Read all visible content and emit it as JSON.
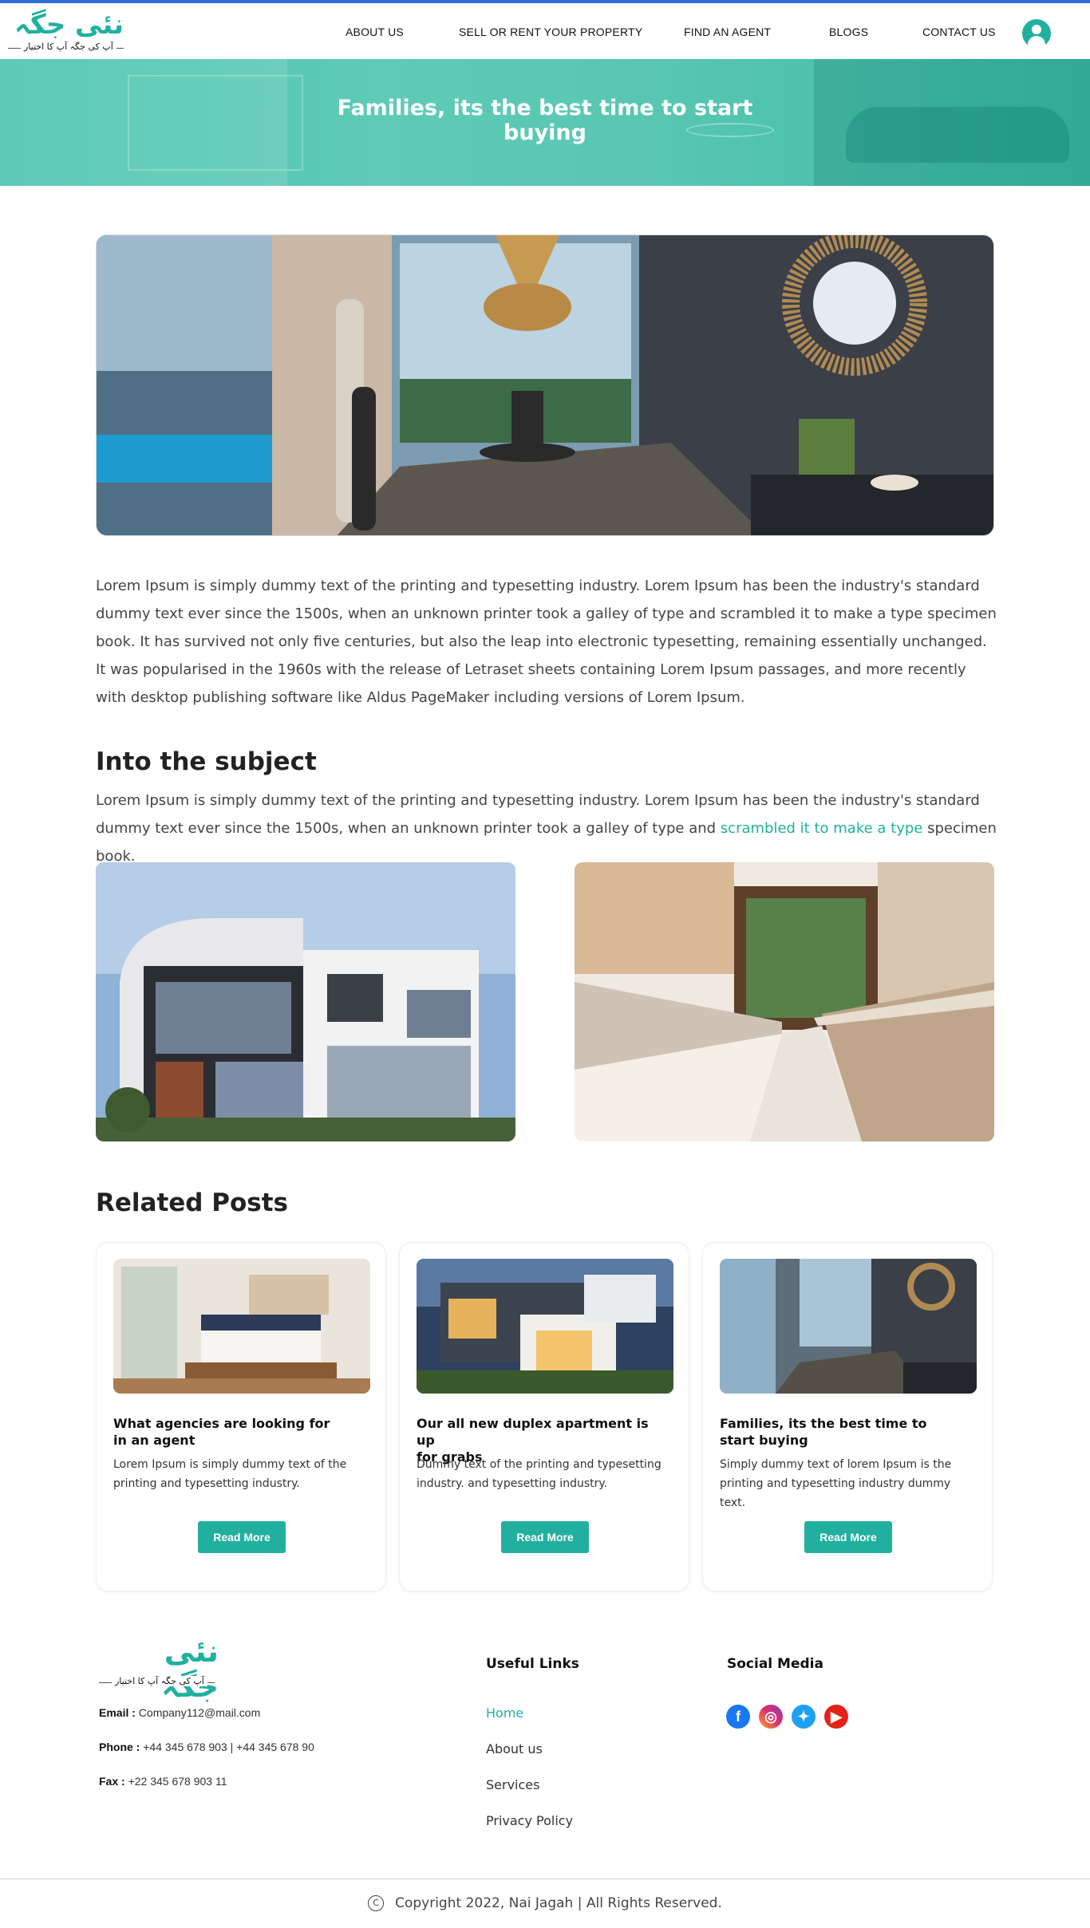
{
  "header": {
    "logo_text": "نئی جگہ",
    "logo_tagline": "آپ کی جگہ آپ کا اختیار",
    "nav": [
      "ABOUT US",
      "SELL OR RENT YOUR PROPERTY",
      "FIND AN AGENT",
      "BLOGS",
      "CONTACT US"
    ],
    "user_icon": "user-circle-icon"
  },
  "hero": {
    "title": "Families, its the best time to start buying"
  },
  "article": {
    "intro": "Lorem Ipsum is simply dummy text of the printing and typesetting industry. Lorem Ipsum has been the industry's standard dummy text ever since the 1500s, when an unknown printer took a galley of type and scrambled it to make a type specimen book. It has survived not only five centuries, but also the leap into electronic typesetting, remaining essentially unchanged. It was popularised in the 1960s with the release of Letraset sheets containing Lorem Ipsum passages, and more recently with desktop publishing software like Aldus PageMaker including versions of Lorem Ipsum.",
    "subject_heading": "Into the subject",
    "subject_text_before": "Lorem Ipsum is simply dummy text of the printing and typesetting industry. Lorem Ipsum has been the industry's standard dummy text ever since the 1500s, when an unknown printer took a galley of type and ",
    "subject_link": "scrambled it to make a type",
    "subject_text_after": " specimen book."
  },
  "related": {
    "heading": "Related Posts",
    "posts": [
      {
        "title": "What agencies are looking for\nin an agent",
        "text": "Lorem Ipsum is simply dummy text of the printing and typesetting industry.",
        "button": "Read More"
      },
      {
        "title": "Our all new duplex apartment is up\nfor grabs",
        "text": "Dummy text of the printing and typesetting industry. and typesetting industry.",
        "button": "Read More"
      },
      {
        "title": "Families, its the best time to\n start buying",
        "text": "Simply dummy text of lorem Ipsum is  the printing and typesetting industry dummy text.",
        "button": "Read More"
      }
    ]
  },
  "footer": {
    "email_label": "Email :",
    "email": "Company112@mail.com",
    "phone_label": "Phone :",
    "phone": "+44 345 678 903  | +44 345 678 90",
    "fax_label": "Fax :",
    "fax": "+22 345 678 903 11",
    "useful_links_heading": "Useful Links",
    "links": [
      "Home",
      "About us",
      "Services",
      "Privacy Policy"
    ],
    "social_heading": "Social Media",
    "social_icons": [
      "facebook-icon",
      "instagram-icon",
      "twitter-icon",
      "youtube-icon"
    ],
    "copyright_symbol": "C",
    "copyright": "Copyright  2022, Nai Jagah |  All Rights Reserved."
  },
  "colors": {
    "accent": "#21b0a0",
    "top_border": "#2f6fd6"
  }
}
